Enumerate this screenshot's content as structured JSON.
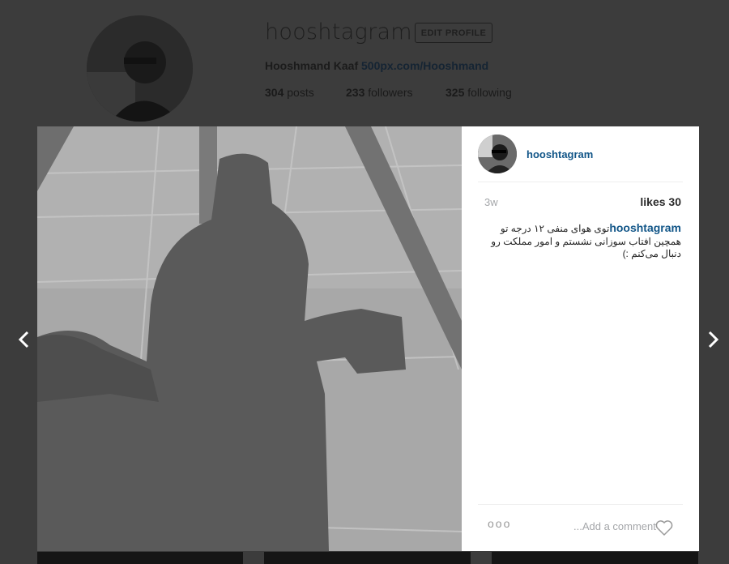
{
  "profile": {
    "username": "hooshtagram",
    "edit_button": "EDIT PROFILE",
    "full_name": "Hooshmand Kaaf",
    "website": "500px.com/Hooshmand",
    "stats": [
      {
        "count": "304",
        "label": "posts"
      },
      {
        "count": "233",
        "label": "followers"
      },
      {
        "count": "325",
        "label": "following"
      }
    ]
  },
  "post": {
    "username": "hooshtagram",
    "time": "3w",
    "likes": "likes 30",
    "caption_user": "hooshtagram",
    "caption_text": "توی هوای منفی ۱۲ درجه تو همچین افتاب سوزانی نشستم و امور مملکت رو دنبال می‌کنم :)",
    "more_label": "ooo",
    "comment_placeholder": "...Add a comment"
  },
  "colors": {
    "overlay_bg": "#3c3c3c",
    "link_blue": "#125688",
    "panel_bg": "#ffffff"
  },
  "icons": {
    "prev": "chevron-left-icon",
    "next": "chevron-right-icon",
    "like": "heart-icon"
  }
}
